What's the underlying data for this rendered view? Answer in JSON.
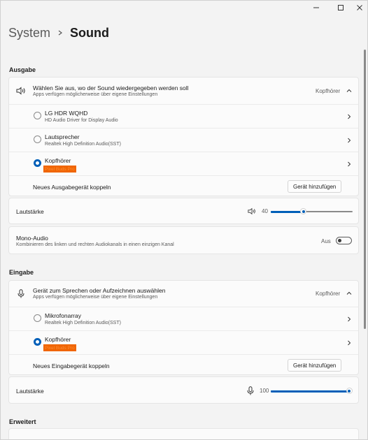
{
  "breadcrumb": {
    "parent": "System",
    "current": "Sound"
  },
  "output": {
    "section_title": "Ausgabe",
    "header": {
      "title": "Wählen Sie aus, wo der Sound wiedergegeben werden soll",
      "subtitle": "Apps verfügen möglicherweise über eigene Einstellungen",
      "selected": "Kopfhörer"
    },
    "devices": [
      {
        "name": "LG HDR WQHD",
        "detail": "HD Audio Driver for Display Audio",
        "selected": false
      },
      {
        "name": "Lautsprecher",
        "detail": "Realtek High Definition Audio(SST)",
        "selected": false
      },
      {
        "name": "Kopfhörer",
        "detail": "Pixel Buds Pro",
        "selected": true
      }
    ],
    "pair_label": "Neues Ausgabegerät koppeln",
    "add_button": "Gerät hinzufügen",
    "volume_label": "Lautstärke",
    "volume_value": "40",
    "volume_level": 0.4,
    "mono": {
      "title": "Mono-Audio",
      "subtitle": "Kombinieren des linken und rechten Audiokanals in einen einzigen Kanal",
      "state_label": "Aus",
      "on": false
    }
  },
  "input": {
    "section_title": "Eingabe",
    "header": {
      "title": "Gerät zum Sprechen oder Aufzeichnen auswählen",
      "subtitle": "Apps verfügen möglicherweise über eigene Einstellungen",
      "selected": "Kopfhörer"
    },
    "devices": [
      {
        "name": "Mikrofonarray",
        "detail": "Realtek High Definition Audio(SST)",
        "selected": false
      },
      {
        "name": "Kopfhörer",
        "detail": "Pixel Buds Pro",
        "selected": true
      }
    ],
    "pair_label": "Neues Eingabegerät koppeln",
    "add_button": "Gerät hinzufügen",
    "volume_label": "Lautstärke",
    "volume_value": "100",
    "volume_level": 1.0
  },
  "advanced": {
    "section_title": "Erweitert"
  },
  "colors": {
    "accent": "#005fb8",
    "highlight": "#f06500"
  },
  "icons": {
    "window": [
      "minimize-icon",
      "maximize-icon",
      "close-icon"
    ],
    "output": "speaker-icon",
    "input": "microphone-icon"
  }
}
